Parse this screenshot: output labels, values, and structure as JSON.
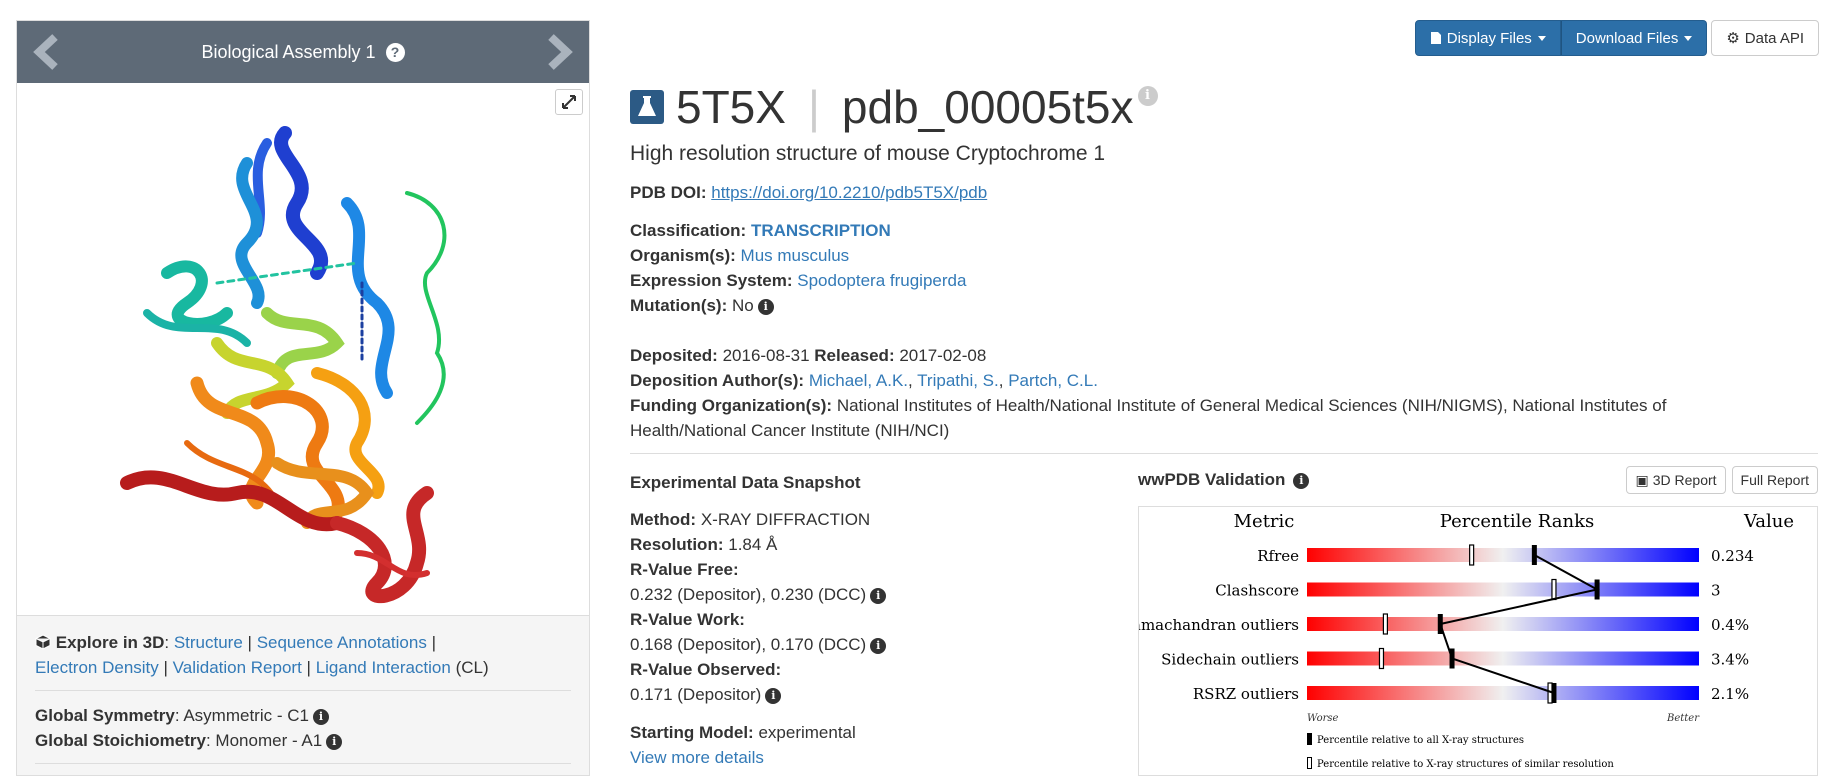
{
  "carousel": {
    "title": "Biological Assembly 1",
    "help_glyph": "?"
  },
  "explore": {
    "label": "Explore in 3D",
    "links": [
      "Structure",
      "Sequence Annotations",
      "Electron Density",
      "Validation Report",
      "Ligand Interaction"
    ],
    "ligand_suffix": "(CL)",
    "global_symmetry_label": "Global Symmetry",
    "global_symmetry_value": ": Asymmetric - C1",
    "global_stoich_label": "Global Stoichiometry",
    "global_stoich_value": ": Monomer - A1"
  },
  "toolbar": {
    "display_files": "Display Files",
    "download_files": "Download Files",
    "data_api": "Data API"
  },
  "entry": {
    "id": "5T5X",
    "separator": "|",
    "pdb_id": "pdb_00005t5x",
    "title": "High resolution structure of mouse Cryptochrome 1",
    "doi_label": "PDB DOI:",
    "doi": "https://doi.org/10.2210/pdb5T5X/pdb",
    "classification_label": "Classification:",
    "classification": "TRANSCRIPTION",
    "organism_label": "Organism(s):",
    "organism": "Mus musculus",
    "expression_label": "Expression System:",
    "expression": "Spodoptera frugiperda",
    "mutation_label": "Mutation(s):",
    "mutation": "No",
    "deposited_label": "Deposited:",
    "deposited": "2016-08-31",
    "released_label": "Released:",
    "released": "2017-02-08",
    "authors_label": "Deposition Author(s):",
    "authors": [
      "Michael, A.K.",
      "Tripathi, S.",
      "Partch, C.L."
    ],
    "funding_label": "Funding Organization(s):",
    "funding_line1": "National Institutes of Health/National Institute of General Medical Sciences (NIH/NIGMS), National Institutes of",
    "funding_line2": "Health/National Cancer Institute (NIH/NCI)"
  },
  "experimental": {
    "heading": "Experimental Data Snapshot",
    "method_label": "Method:",
    "method": "X-RAY DIFFRACTION",
    "resolution_label": "Resolution:",
    "resolution": "1.84 Å",
    "rfree_label": "R-Value Free:",
    "rfree": "0.232 (Depositor), 0.230 (DCC)",
    "rwork_label": "R-Value Work:",
    "rwork": "0.168 (Depositor), 0.170 (DCC)",
    "robs_label": "R-Value Observed:",
    "robs": "0.171 (Depositor)",
    "model_label": "Starting Model:",
    "model": "experimental",
    "more": "View more details"
  },
  "validation": {
    "heading": "wwPDB Validation",
    "report3d": "3D Report",
    "full_report": "Full Report",
    "header_metric": "Metric",
    "header_percentile": "Percentile Ranks",
    "header_value": "Value",
    "worse": "Worse",
    "better": "Better",
    "legend_all": "Percentile relative to all X-ray structures",
    "legend_similar": "Percentile relative to X-ray structures of similar resolution",
    "metrics": [
      {
        "name": "Rfree",
        "value": "0.234",
        "pct_all": 0.58,
        "pct_similar": 0.42
      },
      {
        "name": "Clashscore",
        "value": "3",
        "pct_all": 0.74,
        "pct_similar": 0.63
      },
      {
        "name": "Ramachandran outliers",
        "value": "0.4%",
        "pct_all": 0.34,
        "pct_similar": 0.2
      },
      {
        "name": "Sidechain outliers",
        "value": "3.4%",
        "pct_all": 0.37,
        "pct_similar": 0.19
      },
      {
        "name": "RSRZ outliers",
        "value": "2.1%",
        "pct_all": 0.63,
        "pct_similar": 0.62
      }
    ]
  },
  "colors": {
    "primary": "#2c6fa8",
    "link": "#337ab7",
    "bar": "#5e6a77"
  }
}
